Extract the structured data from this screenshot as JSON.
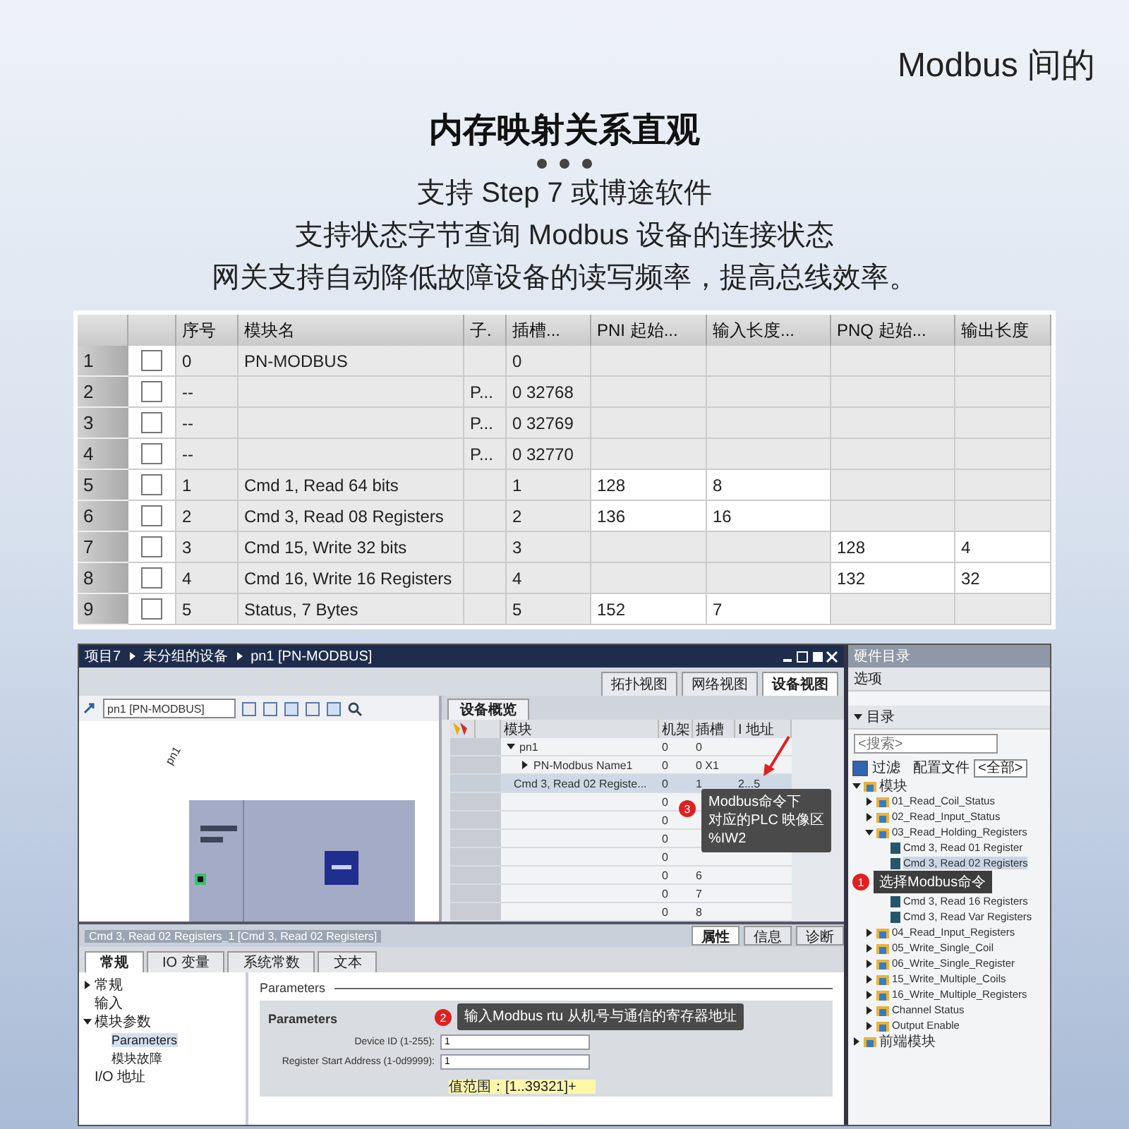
{
  "header": {
    "partial_title": "Modbus 间的",
    "title": "内存映射关系直观",
    "features": [
      "支持 Step 7 或博途软件",
      "支持状态字节查询 Modbus 设备的连接状态",
      "网关支持自动降低故障设备的读写频率，提高总线效率。"
    ]
  },
  "module_table": {
    "columns": [
      "序号",
      "模块名",
      "子.",
      "插槽...",
      "PNI 起始...",
      "输入长度...",
      "PNQ 起始...",
      "输出长度"
    ],
    "rows": [
      {
        "row": "1",
        "checked": false,
        "cells": [
          "0",
          "PN-MODBUS",
          "",
          "0",
          "",
          "",
          "",
          ""
        ]
      },
      {
        "row": "2",
        "checked": false,
        "cells": [
          "--",
          "",
          "P...",
          "0 32768",
          "",
          "",
          "",
          ""
        ]
      },
      {
        "row": "3",
        "checked": false,
        "cells": [
          "--",
          "",
          "P...",
          "0 32769",
          "",
          "",
          "",
          ""
        ]
      },
      {
        "row": "4",
        "checked": false,
        "cells": [
          "--",
          "",
          "P...",
          "0 32770",
          "",
          "",
          "",
          ""
        ]
      },
      {
        "row": "5",
        "checked": false,
        "cells": [
          "1",
          "Cmd 1, Read 64 bits",
          "",
          "1",
          "128",
          "8",
          "",
          ""
        ]
      },
      {
        "row": "6",
        "checked": false,
        "cells": [
          "2",
          "Cmd 3, Read 08 Registers",
          "",
          "2",
          "136",
          "16",
          "",
          ""
        ]
      },
      {
        "row": "7",
        "checked": false,
        "cells": [
          "3",
          "Cmd 15, Write 32 bits",
          "",
          "3",
          "",
          "",
          "128",
          "4"
        ]
      },
      {
        "row": "8",
        "checked": false,
        "cells": [
          "4",
          "Cmd 16, Write 16 Registers",
          "",
          "4",
          "",
          "",
          "132",
          "32"
        ]
      },
      {
        "row": "9",
        "checked": false,
        "cells": [
          "5",
          "Status, 7 Bytes",
          "",
          "5",
          "152",
          "7",
          "",
          ""
        ]
      }
    ]
  },
  "tia": {
    "breadcrumb": [
      "项目7",
      "未分组的设备",
      "pn1 [PN-MODBUS]"
    ],
    "view_tabs": [
      {
        "label": "拓扑视图",
        "selected": false
      },
      {
        "label": "网络视图",
        "selected": false
      },
      {
        "label": "设备视图",
        "selected": true
      }
    ],
    "device_select": "pn1 [PN-MODBUS]",
    "device_label": "pn1",
    "overview": {
      "tab": "设备概览",
      "columns": [
        "模块",
        "机架",
        "插槽",
        "I 地址"
      ],
      "rows": [
        {
          "module": "pn1",
          "rack": "0",
          "slot": "0",
          "address": "",
          "expanded": true,
          "selected": false
        },
        {
          "module": "PN-Modbus Name1",
          "rack": "0",
          "slot": "0 X1",
          "address": "",
          "expanded": false,
          "selected": false
        },
        {
          "module": "Cmd 3, Read 02 Registe...",
          "rack": "0",
          "slot": "1",
          "address": "2...5",
          "selected": true
        },
        {
          "module": "",
          "rack": "0",
          "slot": "",
          "address": "",
          "selected": false
        },
        {
          "module": "",
          "rack": "0",
          "slot": "",
          "address": "",
          "selected": false
        },
        {
          "module": "",
          "rack": "0",
          "slot": "",
          "address": "",
          "selected": false
        },
        {
          "module": "",
          "rack": "0",
          "slot": "",
          "address": "",
          "selected": false
        },
        {
          "module": "",
          "rack": "0",
          "slot": "6",
          "address": "",
          "selected": false
        },
        {
          "module": "",
          "rack": "0",
          "slot": "7",
          "address": "",
          "selected": false
        },
        {
          "module": "",
          "rack": "0",
          "slot": "8",
          "address": "",
          "selected": false
        }
      ],
      "callout": {
        "number": "3",
        "lines": [
          "Modbus命令下",
          "对应的PLC 映像区",
          "%IW2"
        ]
      }
    },
    "inspector": {
      "title": "Cmd 3, Read 02 Registers_1 [Cmd 3, Read 02 Registers]",
      "tabs": [
        {
          "label": "属性",
          "selected": true
        },
        {
          "label": "信息",
          "selected": false
        },
        {
          "label": "诊断",
          "selected": false
        }
      ],
      "subtabs": [
        {
          "label": "常规",
          "selected": true
        },
        {
          "label": "IO 变量",
          "selected": false
        },
        {
          "label": "系统常数",
          "selected": false
        },
        {
          "label": "文本",
          "selected": false
        }
      ],
      "nav": [
        {
          "label": "常规",
          "expanded": false,
          "selected": false
        },
        {
          "label": "输入",
          "selected": false
        },
        {
          "label": "模块参数",
          "expanded": true,
          "selected": false,
          "children": [
            {
              "label": "Parameters",
              "selected": true
            },
            {
              "label": "模块故障",
              "selected": false
            }
          ]
        },
        {
          "label": "I/O 地址",
          "selected": false
        }
      ],
      "section": "Parameters",
      "group": "Parameters",
      "fields": [
        {
          "label": "Device ID (1-255):",
          "value": "1"
        },
        {
          "label": "Register Start Address (1-0d9999):",
          "value": "1"
        }
      ],
      "hint": "值范围：[1..39321]+",
      "callout": {
        "number": "2",
        "text": "输入Modbus rtu 从机号与通信的寄存器地址"
      }
    },
    "catalog": {
      "title": "硬件目录",
      "options": "选项",
      "section": "目录",
      "search_placeholder": "<搜索>",
      "filter": {
        "label": "过滤",
        "checked": true
      },
      "profile_label": "配置文件",
      "profile": "<全部>",
      "tree": [
        {
          "kind": "folder",
          "label": "模块",
          "expanded": true,
          "children": [
            {
              "kind": "folder",
              "label": "01_Read_Coil_Status",
              "expanded": false
            },
            {
              "kind": "folder",
              "label": "02_Read_Input_Status",
              "expanded": false
            },
            {
              "kind": "folder",
              "label": "03_Read_Holding_Registers",
              "expanded": true,
              "children": [
                {
                  "kind": "module",
                  "label": "Cmd 3, Read 01 Register",
                  "selected": false
                },
                {
                  "kind": "module",
                  "label": "Cmd 3, Read 02 Registers",
                  "selected": true
                },
                {
                  "kind": "callout",
                  "number": "1",
                  "text": "选择Modbus命令"
                },
                {
                  "kind": "module",
                  "label": "Cmd 3, Read 16 Registers",
                  "selected": false
                },
                {
                  "kind": "module",
                  "label": "Cmd 3, Read Var Registers",
                  "selected": false
                }
              ]
            },
            {
              "kind": "folder",
              "label": "04_Read_Input_Registers",
              "expanded": false
            },
            {
              "kind": "folder",
              "label": "05_Write_Single_Coil",
              "expanded": false
            },
            {
              "kind": "folder",
              "label": "06_Write_Single_Register",
              "expanded": false
            },
            {
              "kind": "folder",
              "label": "15_Write_Multiple_Coils",
              "expanded": false
            },
            {
              "kind": "folder",
              "label": "16_Write_Multiple_Registers",
              "expanded": false
            },
            {
              "kind": "folder",
              "label": "Channel Status",
              "expanded": false
            },
            {
              "kind": "folder",
              "label": "Output Enable",
              "expanded": false
            }
          ]
        },
        {
          "kind": "folder",
          "label": "前端模块",
          "expanded": false
        }
      ]
    }
  }
}
